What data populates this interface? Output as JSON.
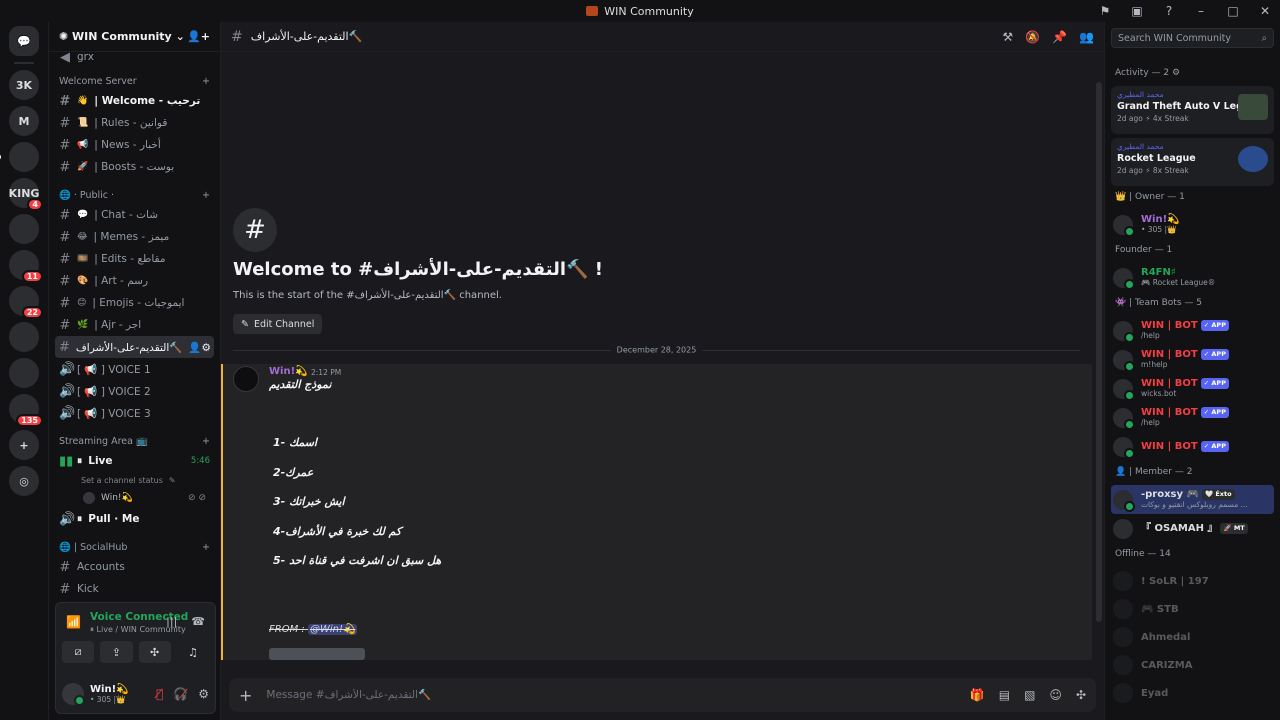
{
  "window": {
    "title": "WIN Community",
    "controls": [
      "inbox-icon",
      "help-icon",
      "minimize-icon",
      "maximize-icon",
      "close-icon"
    ]
  },
  "guilds": [
    {
      "label": "DM",
      "kind": "dm"
    },
    {
      "label": "3K",
      "kind": "server"
    },
    {
      "label": "M",
      "kind": "server"
    },
    {
      "label": "",
      "kind": "server"
    },
    {
      "label": "KING",
      "kind": "server",
      "badge": "4"
    },
    {
      "label": "",
      "kind": "server"
    },
    {
      "label": "",
      "kind": "server",
      "badge": "11"
    },
    {
      "label": "",
      "kind": "server",
      "badge": "22"
    },
    {
      "label": "",
      "kind": "server"
    },
    {
      "label": "",
      "kind": "server"
    },
    {
      "label": "",
      "kind": "server",
      "badge": "135"
    }
  ],
  "server": {
    "name": "WIN Community"
  },
  "sidebar": {
    "top_partial": "grx",
    "welcome_category": "Welcome Server",
    "welcome_channels": [
      {
        "emoji": "👋",
        "label": "| Welcome - ترحيب",
        "bright": true
      },
      {
        "emoji": "📜",
        "label": "| Rules - قوانين"
      },
      {
        "emoji": "📢",
        "label": "| News - أخبار"
      },
      {
        "emoji": "🚀",
        "label": "| Boosts - بوست"
      }
    ],
    "public_category": "· Public ·",
    "public_channels": [
      {
        "emoji": "💬",
        "label": "| Chat - شات"
      },
      {
        "emoji": "😂",
        "label": "| Memes - ميمز"
      },
      {
        "emoji": "🎞️",
        "label": "| Edits - مقاطع"
      },
      {
        "emoji": "🎨",
        "label": "| Art - رسم"
      },
      {
        "emoji": "😊",
        "label": "| Emojis - ايموجيات"
      },
      {
        "emoji": "🌿",
        "label": "| Ajr - اجر"
      }
    ],
    "active_channel": "التقديم-على-الأشراف🔨",
    "voice_channels": [
      "[ 📢 ] VOICE 1",
      "[ 📢 ] VOICE 2",
      "[ 📢 ] VOICE 3"
    ],
    "streaming_category": "Streaming Area 📺",
    "live_channel": {
      "label": "Live",
      "time": "5:46",
      "status": "Set a channel status"
    },
    "voice_user": "Win!💫",
    "pull_me": "Pull · Me",
    "socialhub_category": "| SocialHub",
    "socialhub_channels": [
      "Accounts",
      "Kick"
    ]
  },
  "voice_panel": {
    "status": "Voice Connected",
    "location": "Live / WIN Community"
  },
  "user": {
    "name": "Win!💫",
    "status": "• 305 |👑"
  },
  "channel": {
    "name": "التقديم-على-الأشراف🔨",
    "welcome_title": "Welcome to #التقديم-على-الأشراف🔨 !",
    "welcome_sub": "This is the start of the #التقديم-على-الأشراف🔨 channel.",
    "edit_button": "Edit Channel",
    "date_divider": "December 28, 2025"
  },
  "message": {
    "author": "Win!💫",
    "time": "2:12 PM",
    "title": "نموذج التقديم",
    "lines": [
      "1- اسمك",
      "2-عمرك",
      "3- ايش خبراتك",
      "4-كم لك خبرة في الأشراف",
      "5- هل سبق ان اشرفت في قناة احد"
    ],
    "from_label": "FROM :",
    "from_mention": "@Win!💫"
  },
  "composer": {
    "placeholder": "Message #التقديم-على-الأشراف🔨"
  },
  "members": {
    "search_placeholder": "Search WIN Community",
    "activity_header": "Activity — 2",
    "activities": [
      {
        "who": "محمد المطيري",
        "game": "Grand Theft Auto V Legacy",
        "meta": "2d ago  ⚡ 4x Streak",
        "icon": "gta-icon"
      },
      {
        "who": "محمد المطيري",
        "game": "Rocket League",
        "meta": "2d ago  ⚡ 8x Streak",
        "icon": "rocket-league-icon"
      }
    ],
    "groups": [
      {
        "header": "👑 | Owner — 1",
        "items": [
          {
            "name": "Win!💫",
            "status": "• 305 |👑",
            "color": "#a66bd6",
            "online": true
          }
        ]
      },
      {
        "header": "Founder — 1",
        "items": [
          {
            "name": "R4FN♯",
            "status": "🎮 Rocket League®",
            "color": "#23a55a",
            "online": true
          }
        ]
      },
      {
        "header": "👾 | Team Bots — 5",
        "items": [
          {
            "name": "WIN | BOT",
            "status": "/help",
            "color": "#f23f43",
            "app": "✓ APP",
            "online": true
          },
          {
            "name": "WIN | BOT",
            "status": "m!help",
            "color": "#f23f43",
            "app": "✓ APP",
            "online": true
          },
          {
            "name": "WIN | BOT",
            "status": "wicks.bot",
            "color": "#f23f43",
            "app": "✓ APP",
            "online": true
          },
          {
            "name": "WIN | BOT",
            "status": "/help",
            "color": "#f23f43",
            "app": "✓ APP",
            "online": true
          },
          {
            "name": "WIN | BOT",
            "status": "",
            "color": "#f23f43",
            "app": "✓ APP",
            "online": true
          }
        ]
      },
      {
        "header": "👤 | Member — 2",
        "items": [
          {
            "name": "-proxsy 🎮",
            "status": "مسمم روبلوكس انقتيو و بوكات ...",
            "color": "#dbdee1",
            "online": true,
            "tag": "🤍 Éxto",
            "highlight": true
          },
          {
            "name": "『 OSAMAH 』",
            "status": "",
            "color": "#dbdee1",
            "online": false,
            "tag": "🚀 MT"
          }
        ]
      }
    ],
    "offline_header": "Offline — 14",
    "offline": [
      "! SoLR | 197",
      "🎮 STB",
      "Ahmedal",
      "CARIZMA",
      "Eyad"
    ],
    "colors": {
      "accent": "#5865f2",
      "online": "#23a55a",
      "danger": "#f23f43"
    }
  }
}
